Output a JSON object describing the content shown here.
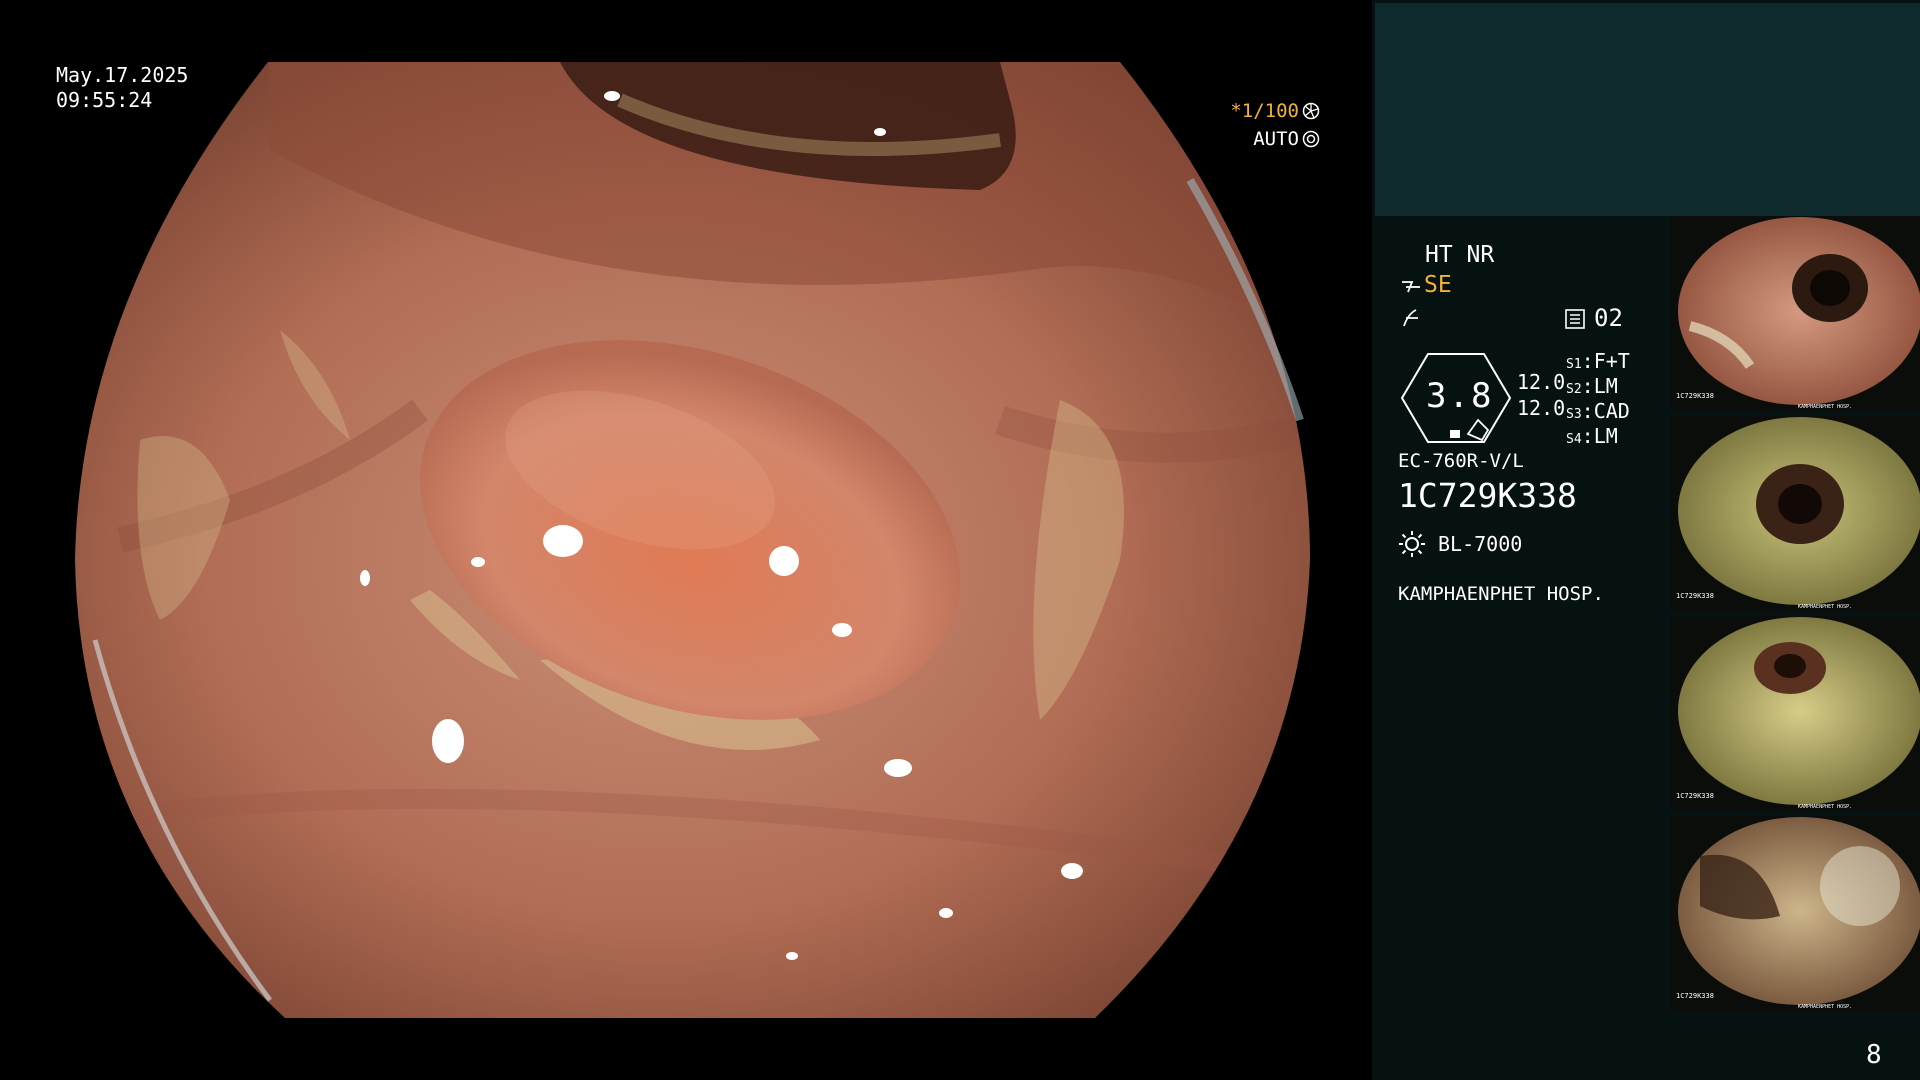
{
  "overlay": {
    "date": "May.17.2025",
    "time": "09:55:24",
    "shutter": "*1/100",
    "iris": "AUTO"
  },
  "panel": {
    "mode_line": "HT NR",
    "enhance_mode": "SE",
    "memory_no": "02",
    "scope_value": "3.8",
    "values": [
      "12.0",
      "12.0"
    ],
    "switches": [
      {
        "key": "S1",
        "value": "F+T"
      },
      {
        "key": "S2",
        "value": "LM"
      },
      {
        "key": "S3",
        "value": "CAD"
      },
      {
        "key": "S4",
        "value": "LM"
      }
    ],
    "scope_model": "EC-760R-V/L",
    "serial": "1C729K338",
    "light_source": "BL-7000",
    "hospital": "KAMPHAENPHET HOSP."
  },
  "thumbnails": [
    {
      "serial": "1C729K338",
      "hospital": "KAMPHAENPHET HOSP."
    },
    {
      "serial": "1C729K338",
      "hospital": "KAMPHAENPHET HOSP."
    },
    {
      "serial": "1C729K338",
      "hospital": "KAMPHAENPHET HOSP."
    },
    {
      "serial": "1C729K338",
      "hospital": "KAMPHAENPHET HOSP."
    }
  ],
  "page_number": "8",
  "colors": {
    "accent": "#f2b233",
    "panel_bg": "#061111",
    "top_box": "#0f2a2d",
    "mucosa": "#b9735a"
  }
}
